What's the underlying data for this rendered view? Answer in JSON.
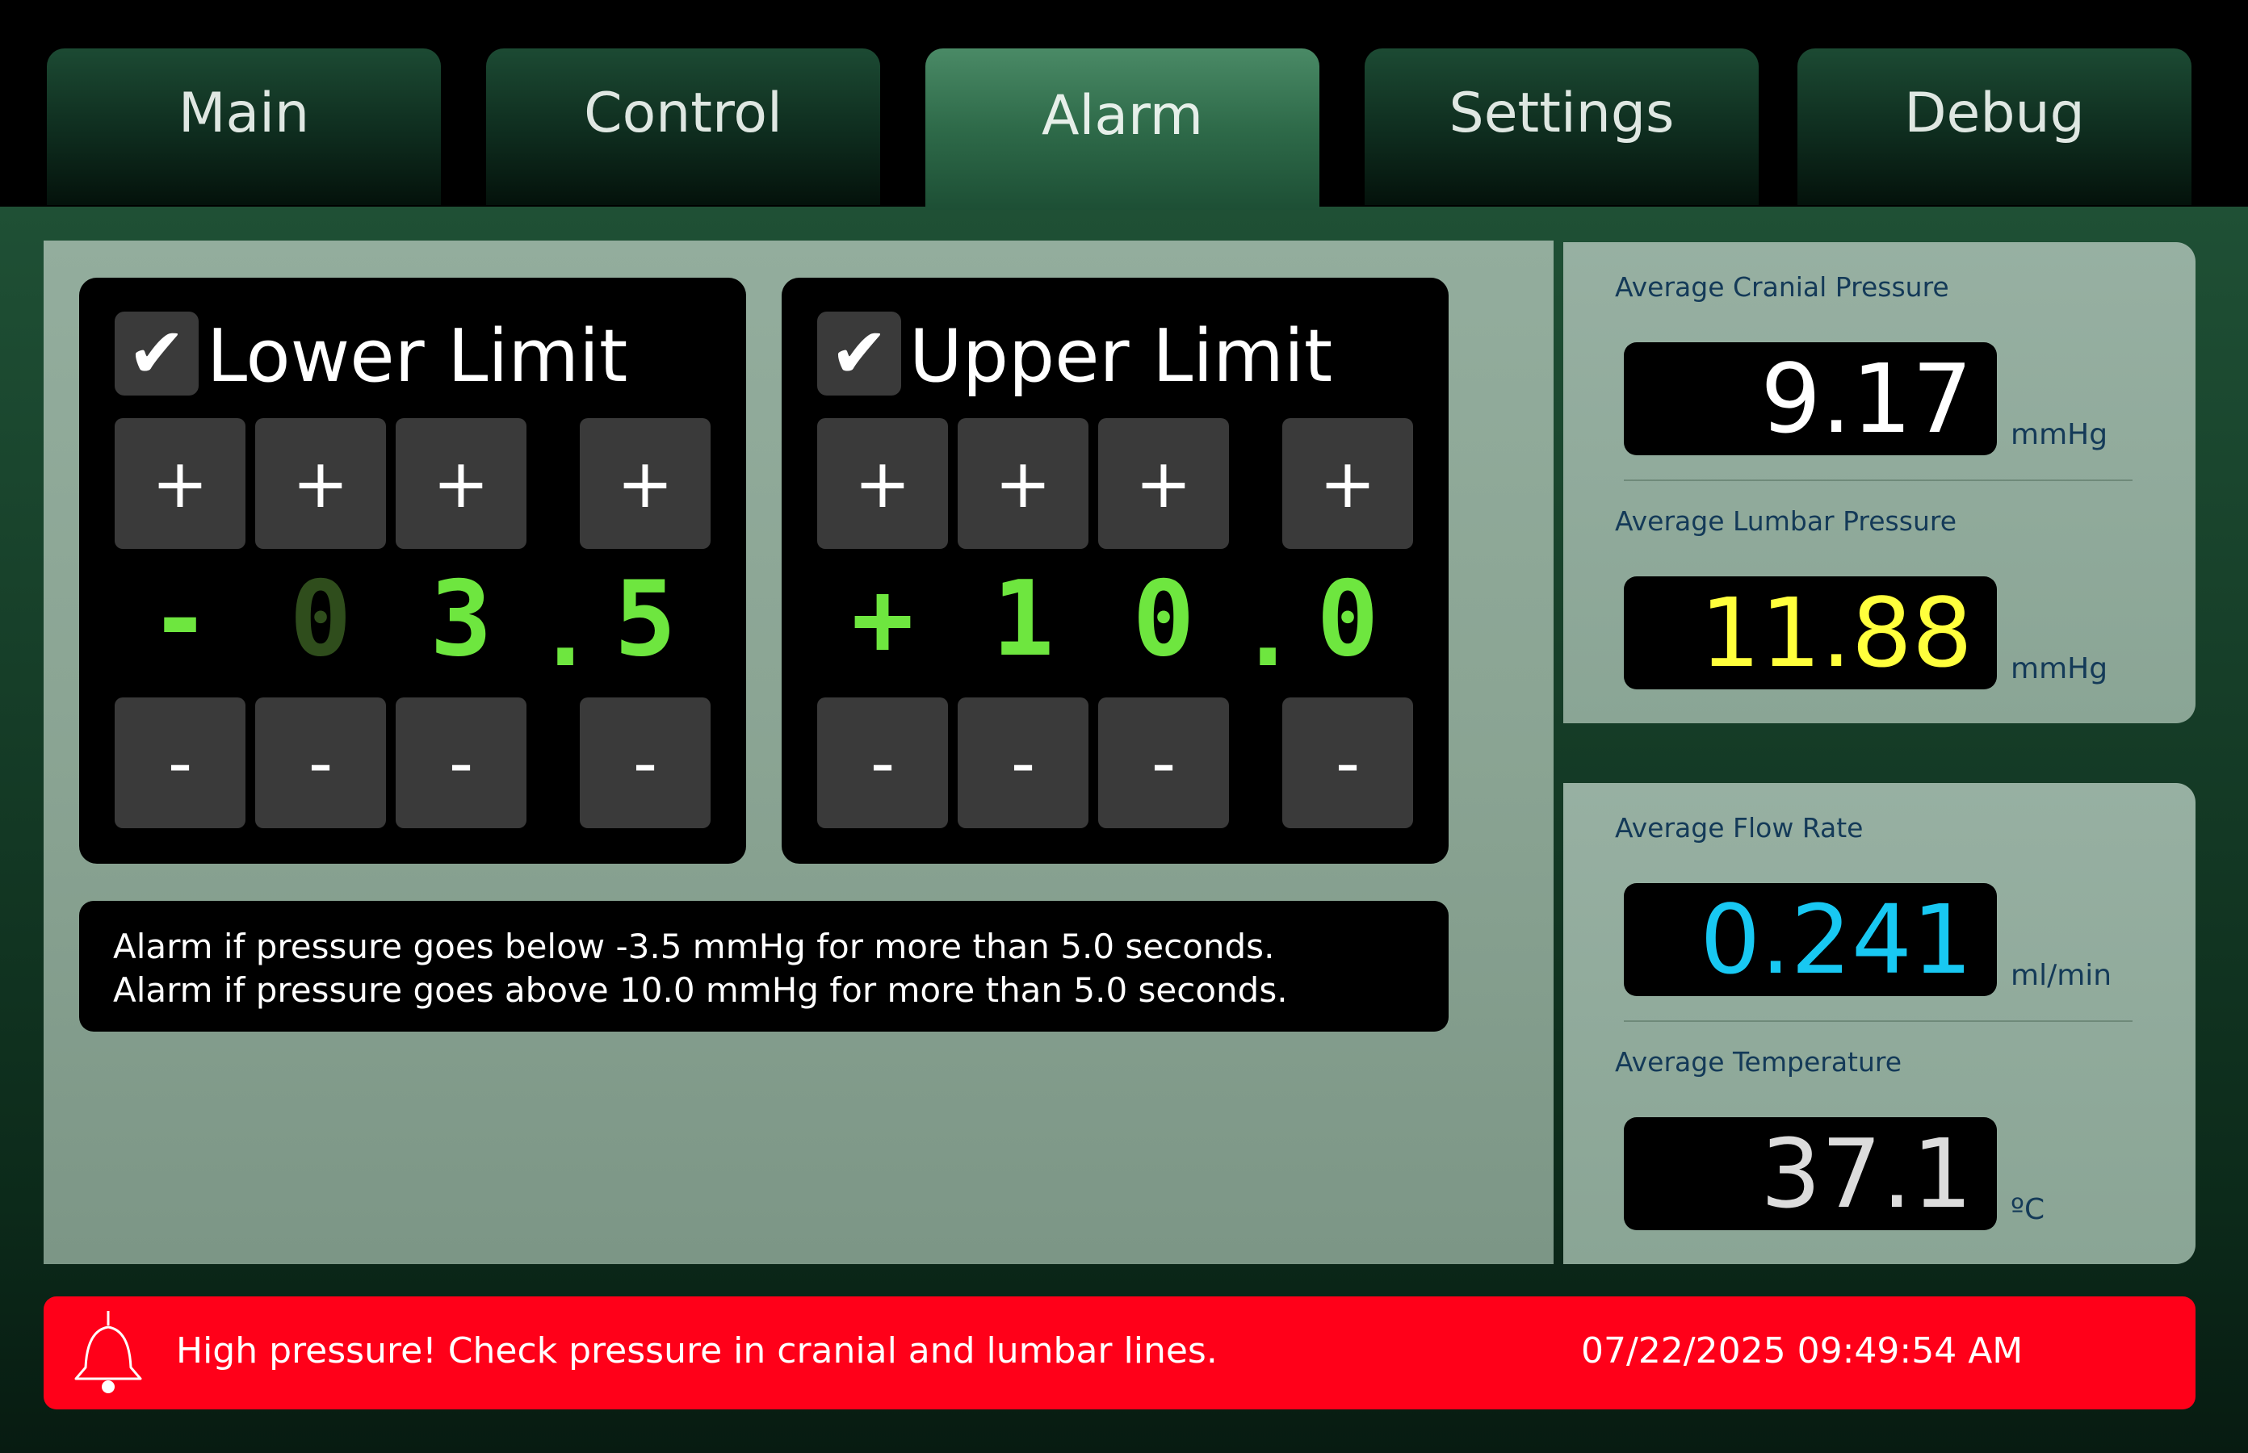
{
  "tabs": [
    {
      "label": "Main"
    },
    {
      "label": "Control"
    },
    {
      "label": "Alarm",
      "active": true
    },
    {
      "label": "Settings"
    },
    {
      "label": "Debug"
    }
  ],
  "lower_limit": {
    "checked": true,
    "title": "Lower Limit",
    "plus_label": "+",
    "minus_label": "-",
    "digits": [
      "-",
      "0",
      "3",
      "5"
    ],
    "decimal": ".",
    "value": -3.5
  },
  "upper_limit": {
    "checked": true,
    "title": "Upper Limit",
    "plus_label": "+",
    "minus_label": "-",
    "digits": [
      "+",
      "1",
      "0",
      "0"
    ],
    "decimal": ".",
    "value": 10.0
  },
  "alarm_messages": {
    "line1": "Alarm if pressure goes below -3.5 mmHg for more than 5.0 seconds.",
    "line2": "Alarm if pressure goes above 10.0 mmHg for more than 5.0 seconds."
  },
  "metrics": {
    "cranial": {
      "label": "Average Cranial Pressure",
      "value": "9.17",
      "unit": "mmHg",
      "color": "#ffffff"
    },
    "lumbar": {
      "label": "Average Lumbar Pressure",
      "value": "11.88",
      "unit": "mmHg",
      "color": "#ffff3c"
    },
    "flow": {
      "label": "Average Flow Rate",
      "value": "0.241",
      "unit": "ml/min",
      "color": "#18c8f2"
    },
    "temperature": {
      "label": "Average Temperature",
      "value": "37.1",
      "unit": "ºC",
      "color": "#dcdcdc"
    }
  },
  "alert": {
    "icon": "bell-icon",
    "message": "High pressure!  Check pressure in cranial and lumbar lines.",
    "timestamp": "07/22/2025 09:49:54 AM",
    "color": "#ff0019"
  },
  "colors": {
    "digit_green": "#6ee63f",
    "digit_dim_green": "#2f4d1c"
  }
}
